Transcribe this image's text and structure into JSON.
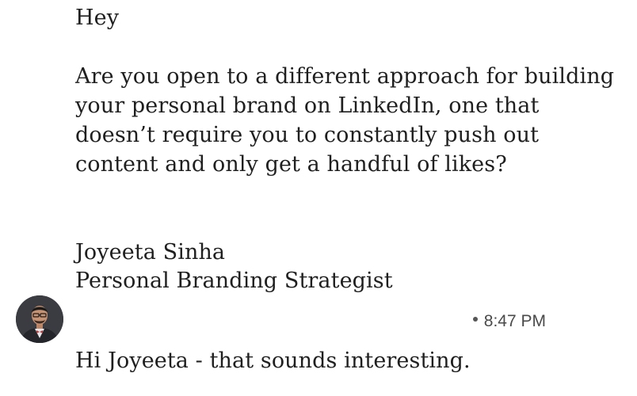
{
  "message": {
    "greeting": "Hey",
    "body": "Are you open to a different approach for building your personal brand on LinkedIn, one that doesn’t require you to constantly push out content and only get a handful of likes?",
    "signature_name": "Joyeeta Sinha",
    "signature_title": "Personal Branding Strategist"
  },
  "reply": {
    "time": "8:47 PM",
    "text": "Hi Joyeeta - that sounds interesting."
  },
  "avatar": {
    "icon": "person-avatar-icon"
  }
}
